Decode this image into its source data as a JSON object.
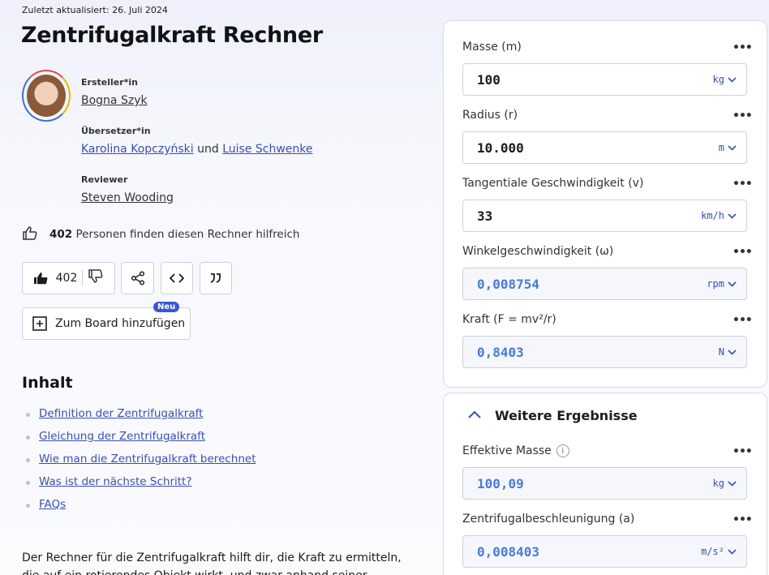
{
  "meta": {
    "updated": "Zuletzt aktualisiert: 26. Juli 2024",
    "title": "Zentrifugalkraft Rechner"
  },
  "contributors": {
    "creator_role": "Ersteller*in",
    "creator": "Bogna Szyk",
    "translator_role": "Übersetzer*in",
    "translator1": "Karolina Kopczyński",
    "and": "und",
    "translator2": "Luise Schwenke",
    "reviewer_role": "Reviewer",
    "reviewer": "Steven Wooding"
  },
  "helpful": {
    "count": "402",
    "text": "Personen finden diesen Rechner hilfreich"
  },
  "actions": {
    "like_count": "402",
    "board_label": "Zum Board hinzufügen",
    "new_badge": "Neu"
  },
  "toc": {
    "title": "Inhalt",
    "items": [
      "Definition der Zentrifugalkraft",
      "Gleichung der Zentrifugalkraft",
      "Wie man die Zentrifugalkraft berechnet",
      "Was ist der nächste Schritt?",
      "FAQs"
    ]
  },
  "intro": "Der Rechner für die Zentrifugalkraft hilft dir, die Kraft zu ermitteln, die auf ein rotierendes Objekt wirkt, und zwar anhand seiner Masse",
  "calculator": {
    "fields": [
      {
        "label": "Masse (m)",
        "value": "100",
        "unit": "kg"
      },
      {
        "label": "Radius (r)",
        "value": "10.000",
        "unit": "m"
      },
      {
        "label": "Tangentiale Geschwindigkeit (v)",
        "value": "33",
        "unit": "km/h"
      },
      {
        "label": "Winkelgeschwindigkeit (ω)",
        "value": "0,008754",
        "unit": "rpm"
      },
      {
        "label": "Kraft (F = mv²/r)",
        "value": "0,8403",
        "unit": "N"
      }
    ],
    "more_title": "Weitere Ergebnisse",
    "more_fields": [
      {
        "label": "Effektive Masse",
        "value": "100,09",
        "unit": "kg"
      },
      {
        "label": "Zentrifugalbeschleunigung (a)",
        "value": "0,008403",
        "unit": "m/s²"
      }
    ],
    "menu_glyph": "•••",
    "info_glyph": "i"
  },
  "colors": {
    "accent": "#3a4fae",
    "result_value": "#4a7bd6",
    "badge": "#3b57d6"
  }
}
